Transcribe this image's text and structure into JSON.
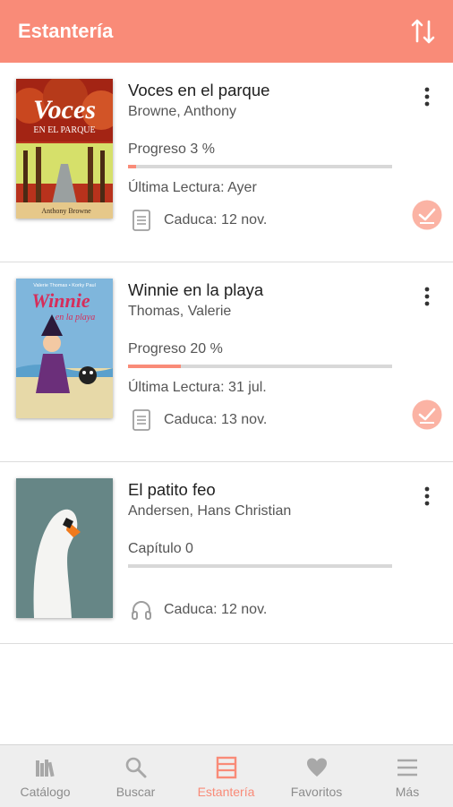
{
  "app": {
    "title": "Estantería"
  },
  "books": [
    {
      "title": "Voces en el parque",
      "author": "Browne, Anthony",
      "progress_label": "Progreso 3 %",
      "progress": 0.03,
      "last_read": "Última Lectura: Ayer",
      "expiry": "Caduca: 12 nov.",
      "type_icon": "document-icon",
      "finished_badge": true,
      "cover_text": {
        "big": "Voces",
        "sub": "EN EL PARQUE",
        "author": "Anthony Browne"
      }
    },
    {
      "title": "Winnie en la playa",
      "author": "Thomas, Valerie",
      "progress_label": "Progreso 20 %",
      "progress": 0.2,
      "last_read": "Última Lectura: 31 jul.",
      "expiry": "Caduca: 13 nov.",
      "type_icon": "document-icon",
      "finished_badge": true,
      "cover_text": {
        "top": "Valerie Thomas • Korky Paul",
        "big": "Winnie",
        "sub": "en la playa"
      }
    },
    {
      "title": "El patito feo",
      "author": "Andersen, Hans Christian",
      "progress_label": "Capítulo 0",
      "progress": 0,
      "last_read": "",
      "expiry": "Caduca: 12 nov.",
      "type_icon": "headphones-icon",
      "finished_badge": false
    }
  ],
  "bottom_nav": [
    {
      "label": "Catálogo",
      "icon": "library-icon",
      "active": false
    },
    {
      "label": "Buscar",
      "icon": "search-icon",
      "active": false
    },
    {
      "label": "Estantería",
      "icon": "shelf-icon",
      "active": true
    },
    {
      "label": "Favoritos",
      "icon": "heart-icon",
      "active": false
    },
    {
      "label": "Más",
      "icon": "hamburger-icon",
      "active": false
    }
  ],
  "colors": {
    "accent": "#f98b78",
    "badge": "#fbb3a4",
    "icon_gray": "#9e9e9e"
  }
}
